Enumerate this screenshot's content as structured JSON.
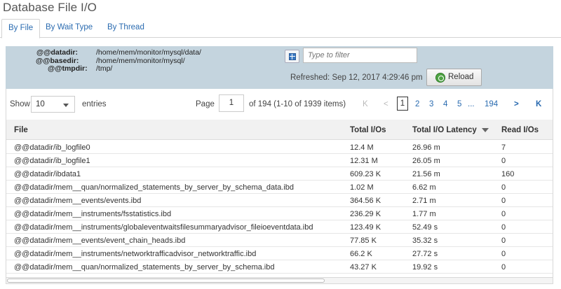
{
  "page_title": "Database File I/O",
  "tabs": [
    "By File",
    "By Wait Type",
    "By Thread"
  ],
  "variables": [
    {
      "name": "@@datadir:",
      "value": "/home/mem/monitor/mysql/data/"
    },
    {
      "name": "@@basedir:",
      "value": "/home/mem/monitor/mysql/"
    },
    {
      "name": "@@tmpdir:",
      "value": "/tmp/"
    }
  ],
  "filter": {
    "placeholder": "Type to filter"
  },
  "refreshed": "Refreshed: Sep 12, 2017 4:29:46 pm",
  "reload_label": "Reload",
  "pager": {
    "show_label": "Show",
    "show_value": "10",
    "entries_label": "entries",
    "page_label": "Page",
    "page_value": "1",
    "of_label": "of 194  (1-10 of 1939 items)",
    "first": "K",
    "prev": "<",
    "current": "1",
    "pages": [
      "2",
      "3",
      "4",
      "5"
    ],
    "ellipsis": "...",
    "last_page": "194",
    "next": ">",
    "last": "K"
  },
  "table": {
    "columns": [
      "File",
      "Total I/Os",
      "Total I/O Latency",
      "Read I/Os"
    ],
    "rows": [
      [
        "@@datadir/ib_logfile0",
        "12.4 M",
        "26.96 m",
        "7"
      ],
      [
        "@@datadir/ib_logfile1",
        "12.31 M",
        "26.05 m",
        "0"
      ],
      [
        "@@datadir/ibdata1",
        "609.23 K",
        "21.56 m",
        "160"
      ],
      [
        "@@datadir/mem__quan/normalized_statements_by_server_by_schema_data.ibd",
        "1.02 M",
        "6.62 m",
        "0"
      ],
      [
        "@@datadir/mem__events/events.ibd",
        "364.56 K",
        "2.71 m",
        "0"
      ],
      [
        "@@datadir/mem__instruments/fsstatistics.ibd",
        "236.29 K",
        "1.77 m",
        "0"
      ],
      [
        "@@datadir/mem__instruments/globaleventwaitsfilesummaryadvisor_fileioeventdata.ibd",
        "123.49 K",
        "52.49 s",
        "0"
      ],
      [
        "@@datadir/mem__events/event_chain_heads.ibd",
        "77.85 K",
        "35.32 s",
        "0"
      ],
      [
        "@@datadir/mem__instruments/networktrafficadvisor_networktraffic.ibd",
        "66.2 K",
        "27.72 s",
        "0"
      ],
      [
        "@@datadir/mem__quan/normalized_statements_by_server_by_schema.ibd",
        "43.27 K",
        "19.92 s",
        "0"
      ]
    ]
  }
}
